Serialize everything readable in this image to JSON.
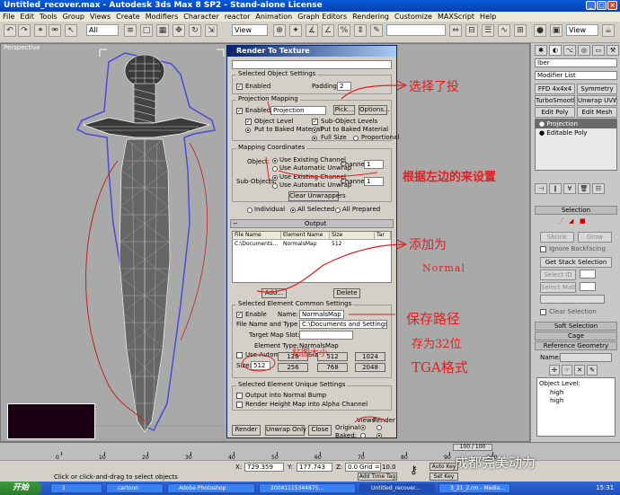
{
  "window": {
    "title": "Untitled_recover.max - Autodesk 3ds Max 8 SP2 - Stand-alone License"
  },
  "menu": [
    "File",
    "Edit",
    "Tools",
    "Group",
    "Views",
    "Create",
    "Modifiers",
    "Character",
    "reactor",
    "Animation",
    "Graph Editors",
    "Rendering",
    "Customize",
    "MAXScript",
    "Help"
  ],
  "toolbar": {
    "selection_filter": "All",
    "coord_system": "View",
    "coord_system_right": "View"
  },
  "viewport": {
    "label": "Perspective"
  },
  "dialog": {
    "title": "Render To Texture",
    "selected_object": {
      "title": "Selected Object Settings",
      "enabled_label": "Enabled",
      "padding_label": "Padding:",
      "padding_value": "2"
    },
    "projection": {
      "title": "Projection Mapping",
      "enabled_label": "Enabled",
      "mapping_value": "Projection",
      "pick_label": "Pick...",
      "options_label": "Options...",
      "object_level": "Object Level",
      "sub_object_levels": "Sub-Object Levels",
      "put_to_baked_material_left": "Put to Baked Material",
      "put_to_baked_material_right": "Put to Baked Material",
      "full_size": "Full Size",
      "proportional": "Proportional"
    },
    "mapping": {
      "title": "Mapping Coordinates",
      "object_label": "Object:",
      "use_existing_channel": "Use Existing Channel",
      "use_automatic_unwrap": "Use Automatic Unwrap",
      "channel_label": "Channel:",
      "channel_value": "1",
      "sub_objects_label": "Sub-Objects:",
      "sub_use_existing": "Use Existing Channel",
      "sub_use_automatic": "Use Automatic Unwrap",
      "sub_channel_value": "1",
      "clear_unwrappers": "Clear Unwrappers"
    },
    "scope": {
      "individual": "Individual",
      "all_selected": "All Selected",
      "all_prepared": "All Prepared"
    },
    "output": {
      "title": "Output",
      "headers": [
        "File Name",
        "Element Name",
        "Size",
        "Tar"
      ],
      "rows": [
        [
          "C:\\Documents...",
          "NormalsMap",
          "512",
          ""
        ]
      ],
      "add_label": "Add...",
      "delete_label": "Delete"
    },
    "element_common": {
      "title": "Selected Element Common Settings",
      "enable_label": "Enable",
      "name_label": "Name:",
      "name_value": "NormalsMap",
      "file_label": "File Name and Type",
      "file_value": "C:\\Documents and Settings\\xiangtac",
      "target_slot_label": "Target Map Slot:",
      "element_type_label": "Element Type:",
      "element_type_value": "NormalsMap",
      "auto_map_size": "Use Automatic Map Size",
      "size_label": "Size:",
      "size_value": "512",
      "size_buttons": [
        "128",
        "512",
        "1024",
        "256",
        "768",
        "2048"
      ]
    },
    "element_unique": {
      "title": "Selected Element Unique Settings",
      "output_normal_bump": "Output into Normal Bump",
      "render_height_map": "Render Height Map into Alpha Channel"
    },
    "footer": {
      "render": "Render",
      "unwrap_only": "Unwrap Only",
      "close": "Close",
      "original_label": "Original:",
      "baked_label": "Baked:",
      "views_label": "Views",
      "render_label": "Render"
    }
  },
  "annotations": {
    "choose_projection": "选择了投",
    "set_by_left": "根据左边的来设置",
    "add_for": "添加为",
    "normal": "Normal",
    "save_path": "保存路径",
    "save_as_32": "存为32位",
    "tga_format": "TGA格式",
    "size_note": "贴图大小"
  },
  "right_panel": {
    "name_value": "Iber",
    "modifier_list": "Modifier List",
    "buttons": [
      "FFD 4x4x4",
      "Symmetry",
      "TurboSmooth",
      "Unwrap UVW",
      "Edit Poly",
      "Edit Mesh"
    ],
    "stack": [
      "Projection",
      "Editable Poly"
    ],
    "selection_title": "Selection",
    "shrink": "Shrink",
    "grow": "Grow",
    "ignore_backfacing": "Ignore Backfacing",
    "get_stack_selection": "Get Stack Selection",
    "select_id": "Select ID",
    "select_matid": "Select MatID",
    "clear_selection": "Clear Selection",
    "soft_selection": "Soft Selection",
    "cage": "Cage",
    "reference_geometry": "Reference Geometry",
    "name_label": "Name:",
    "object_level": "Object Level:",
    "list_items": [
      "high",
      "high"
    ]
  },
  "timeline": {
    "frame": "100 / 100",
    "ticks": [
      "0",
      "10",
      "20",
      "30",
      "40",
      "50",
      "60",
      "70",
      "80",
      "90",
      "100"
    ]
  },
  "status": {
    "prompt": "Click or click-and-drag to select objects",
    "x_value": "729.359",
    "y_value": "177.743",
    "z_value": "0.0",
    "grid": "Grid = 10.0",
    "add_time_tag": "Add Time Tag",
    "set_key": "Set Key",
    "auto_key": "Auto Key"
  },
  "taskbar": {
    "start": "开始",
    "items": [
      "1",
      "cartoon",
      "Adobe Photoshop",
      "20041115344875...",
      "Untitled_recover...",
      "3_21_2.rm - Media..."
    ],
    "clock": "15:31",
    "watermark": "成都完美动力"
  },
  "colors": {
    "dialog_title": "#0a246a",
    "annotation_red": "#e02020",
    "viewport_bg": "#a9a9a9"
  }
}
